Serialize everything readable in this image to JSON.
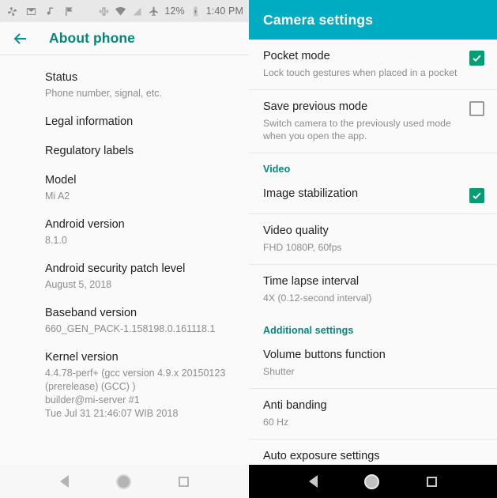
{
  "left_phone": {
    "statusbar": {
      "icons_left": [
        "photos-pinwheel-icon",
        "gmail-icon",
        "music-note-icon",
        "checkmark-flag-icon"
      ],
      "icons_right": [
        "vibrate-icon",
        "wifi-icon",
        "signal-icon-dimmed",
        "airplane-mode-icon"
      ],
      "battery_percent": "12%",
      "battery_icon": "battery-charging-icon",
      "clock": "1:40 PM"
    },
    "appbar": {
      "back_icon": "back-arrow-icon",
      "title": "About phone",
      "title_color": "#00897b"
    },
    "items": [
      {
        "title": "Status",
        "sub": "Phone number, signal, etc."
      },
      {
        "title": "Legal information",
        "sub": ""
      },
      {
        "title": "Regulatory labels",
        "sub": ""
      },
      {
        "title": "Model",
        "sub": "Mi A2"
      },
      {
        "title": "Android version",
        "sub": "8.1.0"
      },
      {
        "title": "Android security patch level",
        "sub": "August 5, 2018"
      },
      {
        "title": "Baseband version",
        "sub": "660_GEN_PACK-1.158198.0.161118.1"
      },
      {
        "title": "Kernel version",
        "sub": "4.4.78-perf+ (gcc version 4.9.x 20150123\n(prerelease) (GCC) )\nbuilder@mi-server #1\nTue Jul 31 21:46:07 WIB 2018"
      }
    ],
    "navbar": {
      "back": "nav-back-icon",
      "home": "nav-home-icon",
      "recents": "nav-recents-icon",
      "theme": "light"
    }
  },
  "right_phone": {
    "appbar": {
      "title": "Camera settings",
      "background": "#00acc1",
      "title_color": "#ffffff"
    },
    "items": [
      {
        "type": "checkbox",
        "title": "Pocket mode",
        "sub": "Lock touch gestures when placed in a pocket",
        "checked": true
      },
      {
        "type": "checkbox",
        "title": "Save previous mode",
        "sub": "Switch camera to the previously used mode when you open the app.",
        "checked": false
      },
      {
        "type": "section",
        "title": "Video"
      },
      {
        "type": "checkbox",
        "title": "Image stabilization",
        "sub": "",
        "checked": true
      },
      {
        "type": "value",
        "title": "Video quality",
        "sub": "FHD 1080P, 60fps"
      },
      {
        "type": "value",
        "title": "Time lapse interval",
        "sub": "4X (0.12-second interval)"
      },
      {
        "type": "section",
        "title": "Additional settings"
      },
      {
        "type": "value",
        "title": "Volume buttons function",
        "sub": "Shutter"
      },
      {
        "type": "value",
        "title": "Anti banding",
        "sub": "60 Hz"
      },
      {
        "type": "value",
        "title": "Auto exposure settings",
        "sub": ""
      }
    ],
    "section_color": "#00897b",
    "checkbox_on_color": "#009e74",
    "navbar": {
      "back": "nav-back-icon",
      "home": "nav-home-icon",
      "recents": "nav-recents-icon",
      "theme": "dark"
    }
  }
}
